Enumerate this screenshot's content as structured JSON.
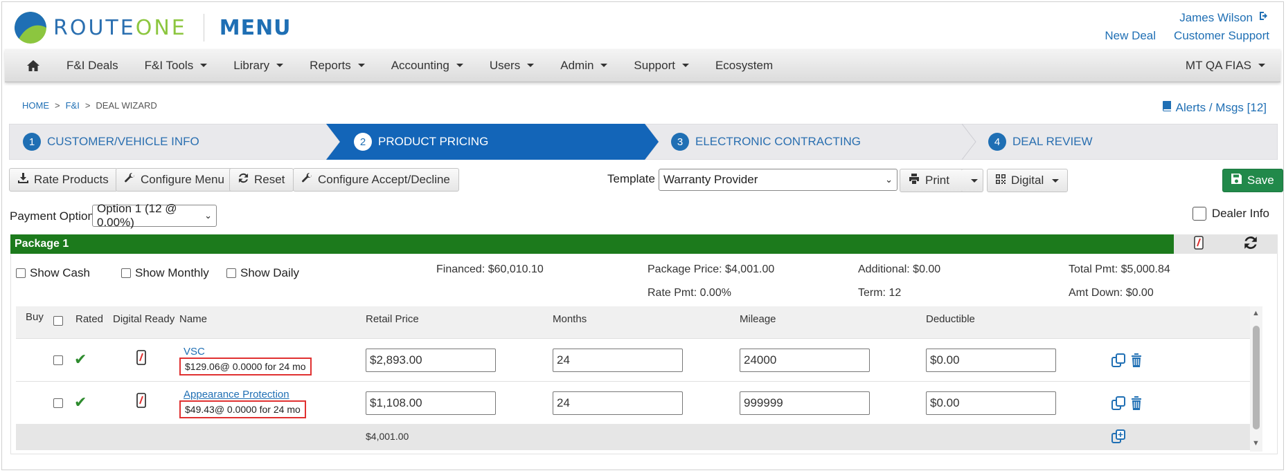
{
  "brand": {
    "route": "ROUTE",
    "one": "ONE",
    "menu": "MENU"
  },
  "user": {
    "name": "James Wilson",
    "new_deal": "New Deal",
    "support": "Customer Support"
  },
  "nav": {
    "items": [
      "F&I Deals",
      "F&I Tools",
      "Library",
      "Reports",
      "Accounting",
      "Users",
      "Admin",
      "Support",
      "Ecosystem"
    ],
    "account": "MT QA FIAS"
  },
  "breadcrumb": {
    "home": "HOME",
    "fi": "F&I",
    "current": "DEAL WIZARD",
    "sep": ">"
  },
  "alerts": "Alerts / Msgs [12]",
  "wizard": {
    "steps": [
      {
        "num": "1",
        "label": "CUSTOMER/VEHICLE INFO"
      },
      {
        "num": "2",
        "label": "PRODUCT PRICING"
      },
      {
        "num": "3",
        "label": "ELECTRONIC CONTRACTING"
      },
      {
        "num": "4",
        "label": "DEAL REVIEW"
      }
    ]
  },
  "toolbar": {
    "rate": "Rate Products",
    "configure_menu": "Configure Menu",
    "reset": "Reset",
    "configure_accept": "Configure Accept/Decline",
    "template_label": "Template",
    "template_value": "Warranty Provider",
    "print": "Print",
    "digital": "Digital",
    "save": "Save"
  },
  "payment": {
    "label": "Payment Option",
    "value": "Option 1 (12 @ 0.00%)"
  },
  "dealer_info": "Dealer Info",
  "package": {
    "title": "Package 1",
    "show_cash": "Show Cash",
    "show_monthly": "Show Monthly",
    "show_daily": "Show Daily",
    "financed": "Financed: $60,010.10",
    "package_price": "Package Price: $4,001.00",
    "rate_pmt": "Rate Pmt: 0.00%",
    "additional": "Additional: $0.00",
    "term": "Term: 12",
    "total_pmt": "Total Pmt: $5,000.84",
    "amt_down": "Amt Down: $0.00"
  },
  "table": {
    "headers": {
      "buy": "Buy",
      "rated": "Rated",
      "digital": "Digital Ready",
      "name": "Name",
      "retail": "Retail Price",
      "months": "Months",
      "mileage": "Mileage",
      "deductible": "Deductible"
    },
    "rows": [
      {
        "name": "VSC",
        "pmt": "$129.06@ 0.0000 for 24 mo",
        "retail": "$2,893.00",
        "months": "24",
        "mileage": "24000",
        "deductible": "$0.00"
      },
      {
        "name": "Appearance Protection",
        "pmt": "$49.43@ 0.0000 for 24 mo",
        "retail": "$1,108.00",
        "months": "24",
        "mileage": "999999",
        "deductible": "$0.00"
      }
    ],
    "total": "$4,001.00"
  },
  "colors": {
    "brand_blue": "#1f6fb4",
    "accent_green": "#8cc63f",
    "package_green": "#1c7a1c",
    "save_green": "#21894a",
    "highlight_red": "#e03030"
  },
  "icons": [
    "home-icon",
    "logout-icon",
    "book-icon",
    "download-icon",
    "wrench-icon",
    "refresh-icon",
    "print-icon",
    "qr-icon",
    "save-icon",
    "check-icon",
    "phone-icon",
    "copy-icon",
    "trash-icon"
  ]
}
